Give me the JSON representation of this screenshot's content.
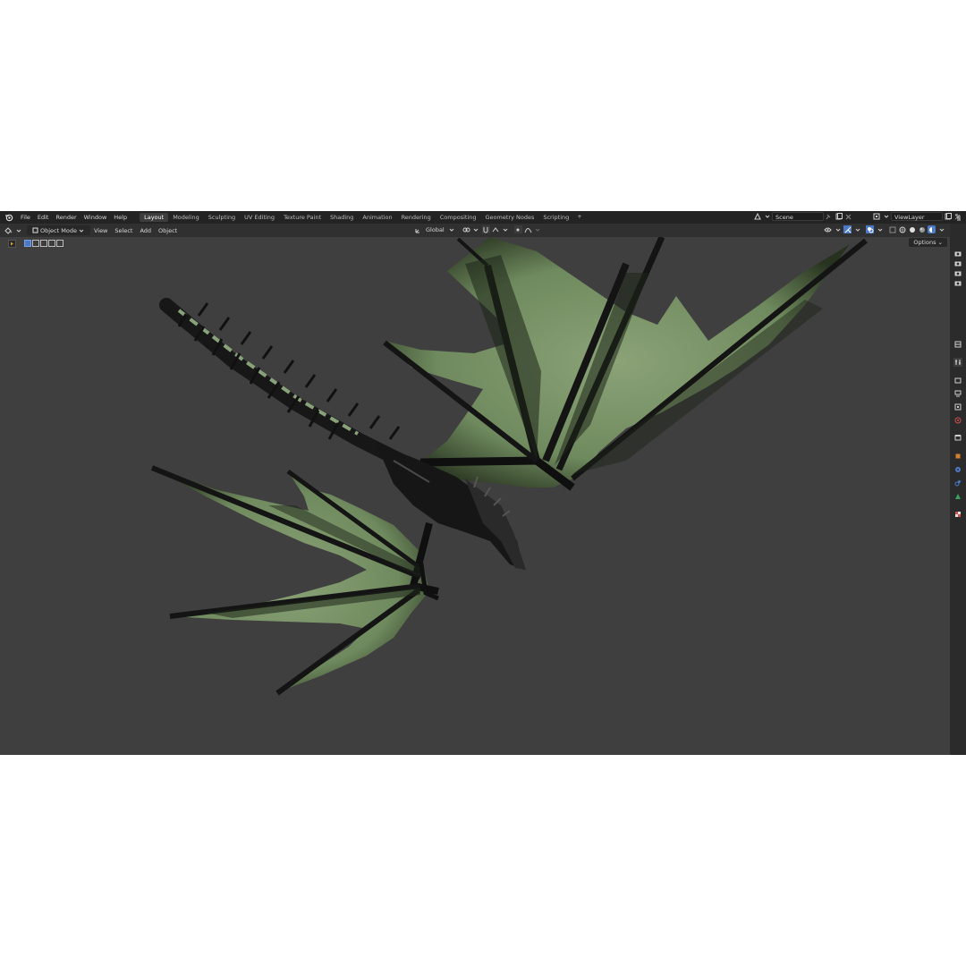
{
  "menu": {
    "items": [
      "File",
      "Edit",
      "Render",
      "Window",
      "Help"
    ]
  },
  "workspaces": {
    "tabs": [
      "Layout",
      "Modeling",
      "Sculpting",
      "UV Editing",
      "Texture Paint",
      "Shading",
      "Animation",
      "Rendering",
      "Compositing",
      "Geometry Nodes",
      "Scripting"
    ],
    "active": "Layout",
    "add_symbol": "+"
  },
  "scene": {
    "value": "Scene"
  },
  "view_layer": {
    "value": "ViewLayer"
  },
  "viewport_header": {
    "mode": "Object Mode",
    "menus": [
      "View",
      "Select",
      "Add",
      "Object"
    ],
    "transform_orientation": "Global",
    "options_label": "Options"
  },
  "icons": {
    "blender_logo": "blender-logo-icon",
    "editor_type": "editor-type-icon",
    "scene": "scene-icon",
    "view_layer": "view-layer-icon",
    "pin": "pin-icon",
    "new": "new-icon",
    "close": "close-icon",
    "outliner_toggle": "outliner-icon"
  },
  "colors": {
    "topbar": "#232323",
    "header": "#303030",
    "viewport": "#3f3f3f",
    "active_tab": "#3d3d3d",
    "accent_blue": "#4b79c6",
    "wing_membrane": "#6f8a5e",
    "dragon_body": "#141414"
  }
}
